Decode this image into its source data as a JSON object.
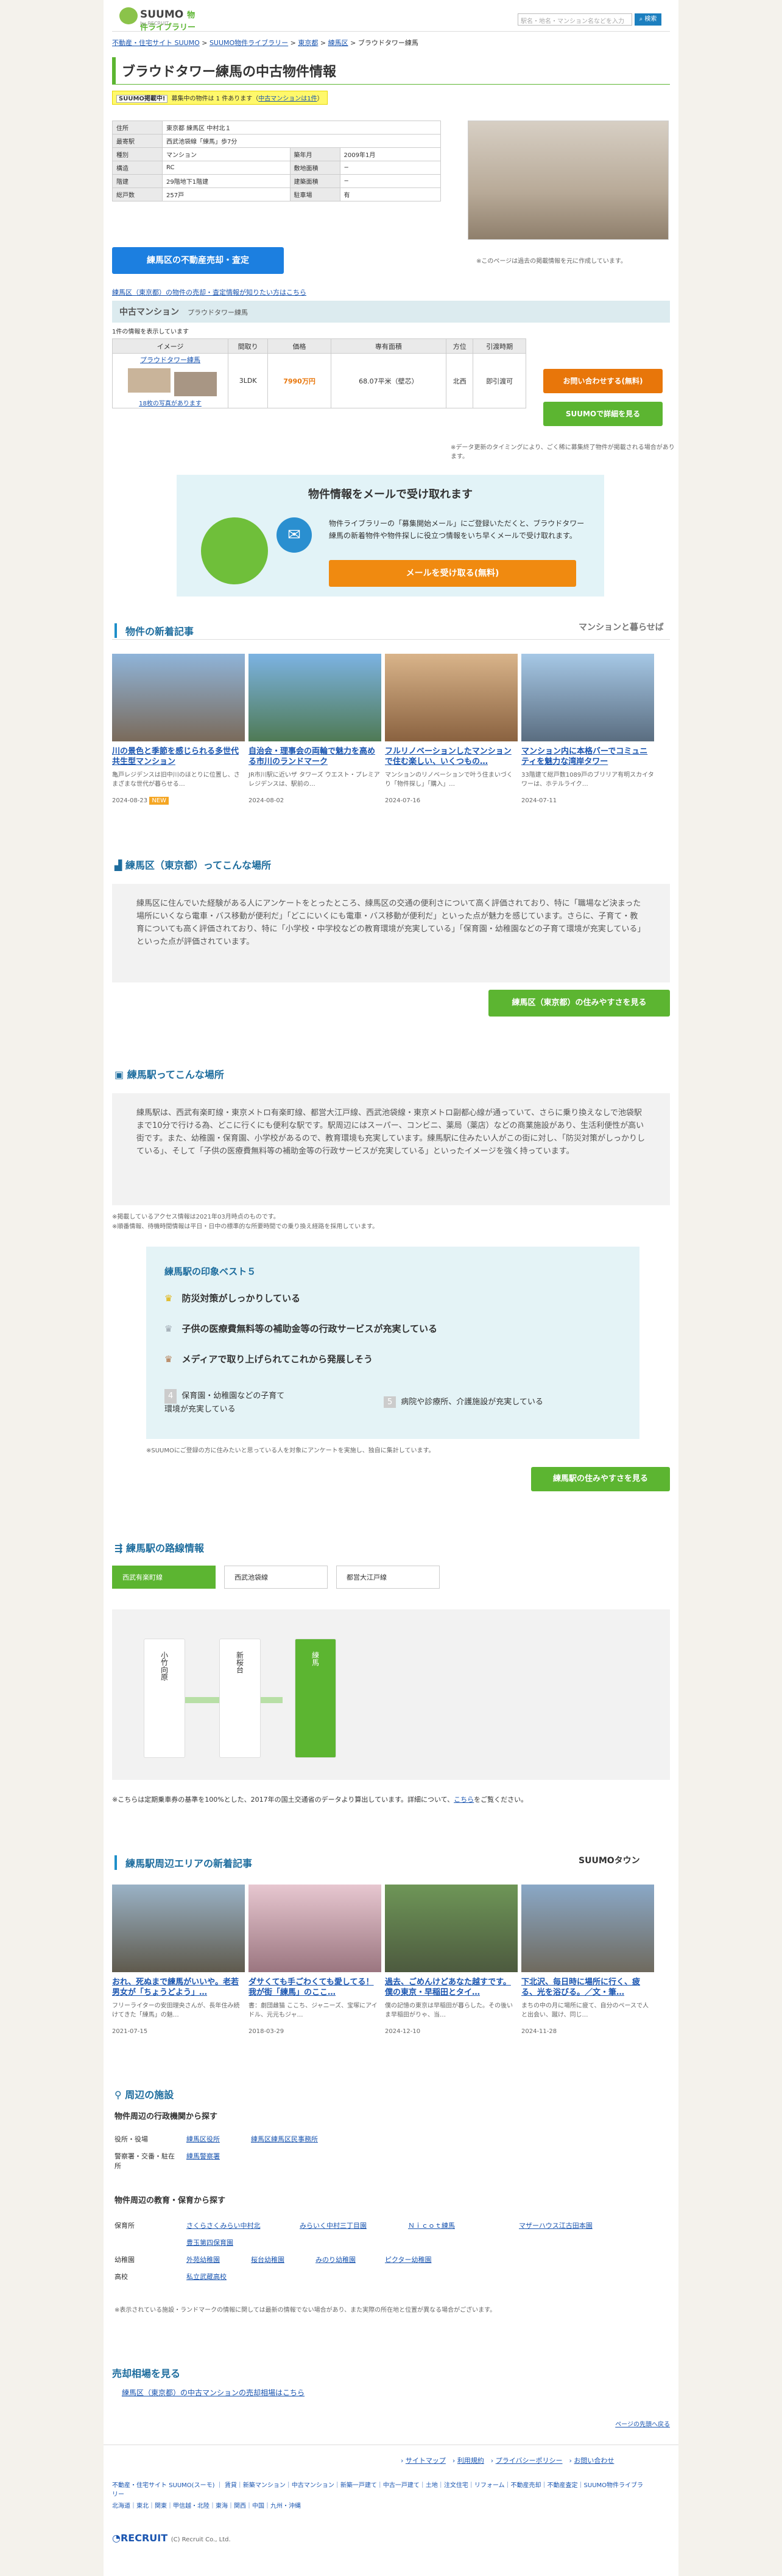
{
  "header": {
    "brand": "SUUMO",
    "brand_sub": "物件ライブラリー",
    "tagline": "by RECRUIT",
    "search_placeholder": "駅名・地名・マンション名などを入力",
    "search_button": "検索"
  },
  "breadcrumb": [
    "不動産・住宅サイト SUUMO",
    "SUUMO物件ライブラリー",
    "東京都",
    "練馬区",
    "ブラウドタワー練馬"
  ],
  "title": "ブラウドタワー練馬の中古物件情報",
  "notice": {
    "badge": "SUUMO掲載中!",
    "text": "募集中の物件は 1 件あります（",
    "link": "中古マンションは1件",
    "tail": "）"
  },
  "spec": [
    [
      "住所",
      "東京都 練馬区 中村北１",
      "",
      ""
    ],
    [
      "最寄駅",
      "西武池袋線「練馬」歩7分",
      "",
      ""
    ],
    [
      "種別",
      "マンション",
      "築年月",
      "2009年1月"
    ],
    [
      "構造",
      "RC",
      "敷地面積",
      "−"
    ],
    [
      "階建",
      "29階地下1階建",
      "建築面積",
      "−"
    ],
    [
      "総戸数",
      "257戸",
      "駐車場",
      "有"
    ]
  ],
  "photo_note": "※このページは過去の掲載情報を元に作成しています。",
  "sell_button": "練馬区の不動産売却・査定",
  "sell_link": "練馬区（東京都）の物件の売却・査定情報が知りたい方はこちら",
  "listing": {
    "section": "中古マンション",
    "section_name": "プラウドタワー練馬",
    "count": "1件の情報を表示しています",
    "headers": [
      "イメージ",
      "間取り",
      "価格",
      "専有面積",
      "方位",
      "引渡時期"
    ],
    "name": "プラウドタワー練馬",
    "photos": "18枚の写真があります",
    "layout": "3LDK",
    "price": "7990万円",
    "area": "68.07平米（壁芯）",
    "dir": "北西",
    "delivery": "即引渡可",
    "inquiry": "お問い合わせする(無料)",
    "detail": "SUUMOで詳細を見る",
    "note": "※データ更新のタイミングにより、ごく稀に募集終了物件が掲載される場合があります。"
  },
  "mail": {
    "title": "物件情報をメールで受け取れます",
    "text": "物件ライブラリーの「募集開始メール」にご登録いただくと、ブラウドタワー練馬の新着物件や物件探しに役立つ情報をいち早くメールで受け取れます。",
    "button": "メールを受け取る(無料)"
  },
  "articles": {
    "title": "物件の新着記事",
    "brand": "マンションと暮らせば",
    "items": [
      {
        "t": "川の景色と季節を感じられる多世代共生型マンション",
        "x": "亀戸レジデンスは旧中川のほとりに位置し、さまざまな世代が暮らせる…",
        "d": "2024-08-23",
        "new": "NEW"
      },
      {
        "t": "自治会・理事会の両輪で魅力を高める市川のランドマーク",
        "x": "JR市川駅に近いザ タワーズ ウエスト・プレミアレジデンスは、駅前の…",
        "d": "2024-08-02",
        "new": ""
      },
      {
        "t": "フルリノベーションしたマンションで住む楽しい、いくつもの…",
        "x": "マンションのリノベーションで叶う住まいづくり「物件探し」「購入」…",
        "d": "2024-07-16",
        "new": ""
      },
      {
        "t": "マンション内に本格バーでコミュニティを魅力な湾岸タワー",
        "x": "33階建て総戸数1089戸のブリリア有明スカイタワーは、ホテルライク…",
        "d": "2024-07-11",
        "new": ""
      }
    ]
  },
  "area": {
    "title": "練馬区（東京都）ってこんな場所",
    "text": "練馬区に住んでいた経験がある人にアンケートをとったところ、練馬区の交通の便利さについて高く評価されており、特に「職場など決まった場所にいくなら電車・バス移動が便利だ」「どこにいくにも電車・バス移動が便利だ」といった点が魅力を感じています。さらに、子育て・教育についても高く評価されており、特に「小学校・中学校などの教育環境が充実している」「保育園・幼稚園などの子育て環境が充実している」といった点が評価されています。",
    "button": "練馬区（東京都）の住みやすさを見る"
  },
  "station": {
    "title": "練馬駅ってこんな場所",
    "text": "練馬駅は、西武有楽町線・東京メトロ有楽町線、都営大江戸線、西武池袋線・東京メトロ副都心線が通っていて、さらに乗り換えなしで池袋駅まで10分で行ける為、どこに行くにも便利な駅です。駅周辺にはスーパー、コンビニ、薬局（薬店）などの商業施設があり、生活利便性が高い街です。また、幼稚園・保育園、小学校があるので、教育環境も充実しています。練馬駅に住みたい人がこの街に対し、「防災対策がしっかりしている」、そして「子供の医療費無料等の補助金等の行政サービスが充実している」といったイメージを強く持っています。",
    "notes": [
      "※掲載しているアクセス情報は2021年03月時点のものです。",
      "※順番情報、待機時間情報は平日・日中の標準的な所要時間での乗り換え経路を採用しています。"
    ],
    "rank_title": "練馬駅の印象ベスト５",
    "ranks": [
      "防災対策がしっかりしている",
      "子供の医療費無料等の補助金等の行政サービスが充実している",
      "メディアで取り上げられてこれから発展しそう",
      "保育園・幼稚園などの子育て環境が充実している",
      "病院や診療所、介護施設が充実している"
    ],
    "survey": "※SUUMOにご登録の方に住みたいと思っている人を対象にアンケートを実施し、独自に集計しています。",
    "button": "練馬駅の住みやすさを見る"
  },
  "routes": {
    "title": "練馬駅の路線情報",
    "tabs": [
      "西武有楽町線",
      "西武池袋線",
      "都営大江戸線"
    ],
    "stations": [
      "小竹向原",
      "新桜台",
      "練馬"
    ],
    "note": "※こちらは定期乗車券の基準を100%とした、2017年の国土交通省のデータより算出しています。詳細について、",
    "note_link": "こちら",
    "note_tail": "をご覧ください。"
  },
  "area_articles": {
    "title": "練馬駅周辺エリアの新着記事",
    "brand": "SUUMOタウン",
    "items": [
      {
        "t": "おれ、死ぬまで練馬がいいや。老若男女が「ちょうどよう」…",
        "x": "フリーライターの安田理央さんが、長年住み続けてきた「練馬」の魅…",
        "d": "2021-07-15"
      },
      {
        "t": "ダサくても手ごわくても愛してる！我が街「練馬」のここ…",
        "x": "書：劇団雌猫 ここち、ジャニーズ、宝塚にアイドル、元元もジャ…",
        "d": "2018-03-29"
      },
      {
        "t": "過去、ごめんけどあなた越すです。僕の東京・早稲田とタイ…",
        "x": "僕の記憶の東京は早稲田が暮らした。その後いま早稲田がりゃ、当…",
        "d": "2024-12-10"
      },
      {
        "t": "下北沢、毎日時に場所に行く、疲る、光を浴びる。／文・筆…",
        "x": "まちの中の月に場所に疲て、自分のペースで人と出会い、蹴け、同じ…",
        "d": "2024-11-28"
      }
    ]
  },
  "facilities": {
    "title": "周辺の施設",
    "gov_title": "物件周辺の行政機関から探す",
    "gov": [
      {
        "k": "役所・役場",
        "v": [
          "練馬区役所",
          "練馬区練馬区民事務所"
        ]
      },
      {
        "k": "警察署・交番・駐在所",
        "v": [
          "練馬警察署"
        ]
      }
    ],
    "edu_title": "物件周辺の教育・保育から探す",
    "edu": [
      {
        "k": "保育所",
        "v": [
          "さくらさくみらい中村北",
          "みらいく中村三丁目園",
          "Ｎｉｃｏｔ練馬",
          "マザーハウス江古田本園",
          "豊玉第四保育園"
        ]
      },
      {
        "k": "幼稚園",
        "v": [
          "外苑幼稚園",
          "桜台幼稚園",
          "みのり幼稚園",
          "ピクター幼稚園"
        ]
      },
      {
        "k": "高校",
        "v": [
          "私立武蔵高校"
        ]
      }
    ],
    "note": "※表示されている施設・ランドマークの情報に関しては最新の情報でない場合があり、また実際の所在地と位置が異なる場合がございます。"
  },
  "market": {
    "title": "売却相場を見る",
    "link": "練馬区（東京都）の中古マンションの売却相場はこちら"
  },
  "pagetop": "ページの先頭へ戻る",
  "footer": {
    "links": [
      "サイトマップ",
      "利用規約",
      "プライバシーポリシー",
      "お問い合わせ"
    ],
    "small1": "不動産・住宅サイト SUUMO(スーモ) ｜ 賃貸｜新築マンション｜中古マンション｜新築一戸建て｜中古一戸建て｜土地｜注文住宅｜リフォーム｜不動産売却｜不動産査定｜SUUMO物件ライブラリー",
    "small2": "北海道｜東北｜関東｜甲信越・北陸｜東海｜関西｜中国｜九州・沖縄",
    "copyright": "(C) Recruit Co., Ltd.",
    "company": "RECRUIT"
  }
}
